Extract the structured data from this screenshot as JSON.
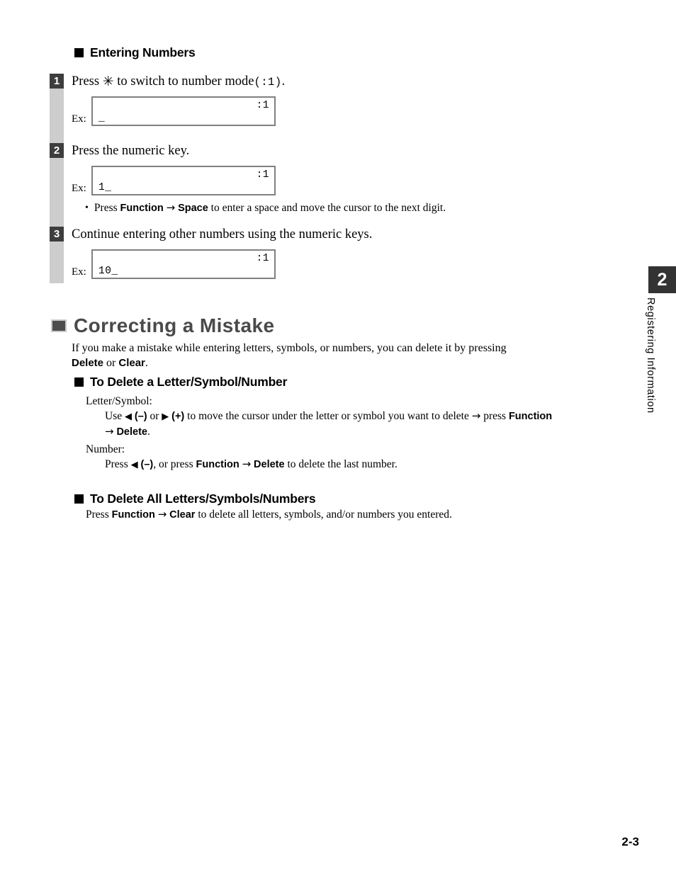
{
  "page": {
    "folio": "2-3",
    "chapter_tab": {
      "number": "2",
      "label": "Registering Information"
    }
  },
  "entering_numbers": {
    "heading": "Entering Numbers",
    "steps": [
      {
        "number": "1",
        "text_before": "Press",
        "star_glyph": "✳",
        "text_mid": "to switch to number mode",
        "code": "(:1)",
        "text_after": ".",
        "example": {
          "label": "Ex:",
          "line1": ":1",
          "line2": "_"
        }
      },
      {
        "number": "2",
        "text": "Press the numeric key.",
        "example": {
          "label": "Ex:",
          "line1": ":1",
          "line2": "1_"
        },
        "note": {
          "bullet": "•",
          "t1": "Press ",
          "k1": "Function",
          "arrow": "→",
          "k2": "Space",
          "t2": " to enter a space and move the cursor to the next digit."
        }
      },
      {
        "number": "3",
        "text": "Continue entering other numbers using the numeric keys.",
        "example": {
          "label": "Ex:",
          "line1": ":1",
          "line2": "10_"
        }
      }
    ]
  },
  "correcting": {
    "heading": "Correcting a Mistake",
    "intro": {
      "t1": "If you make a mistake while entering letters, symbols, or numbers, you can delete it by pressing",
      "k1": "Delete",
      "t2": " or ",
      "k2": "Clear",
      "t3": "."
    },
    "delete_one": {
      "heading": "To Delete a Letter/Symbol/Number",
      "letter_symbol": {
        "term": "Letter/Symbol:",
        "t1": "Use ",
        "tri_left": "◀",
        "k_minus": "(–)",
        "t2": " or ",
        "tri_right": "▶",
        "k_plus": "(+)",
        "t3": " to move the cursor under the letter or symbol you want to delete ",
        "arrow1": "→",
        "t4": " press ",
        "k1": "Function",
        "arrow2": "→",
        "k2": "Delete",
        "t5": "."
      },
      "number": {
        "term": "Number:",
        "t1": "Press ",
        "tri_left": "◀",
        "k_minus": "(–)",
        "t2": ", or press ",
        "k1": "Function",
        "arrow": "→",
        "k2": "Delete",
        "t3": " to delete the last number."
      }
    },
    "delete_all": {
      "heading": "To Delete All Letters/Symbols/Numbers",
      "body": {
        "t1": "Press ",
        "k1": "Function",
        "arrow": "→",
        "k2": "Clear",
        "t2": " to delete all letters, symbols, and/or numbers you entered."
      }
    }
  }
}
